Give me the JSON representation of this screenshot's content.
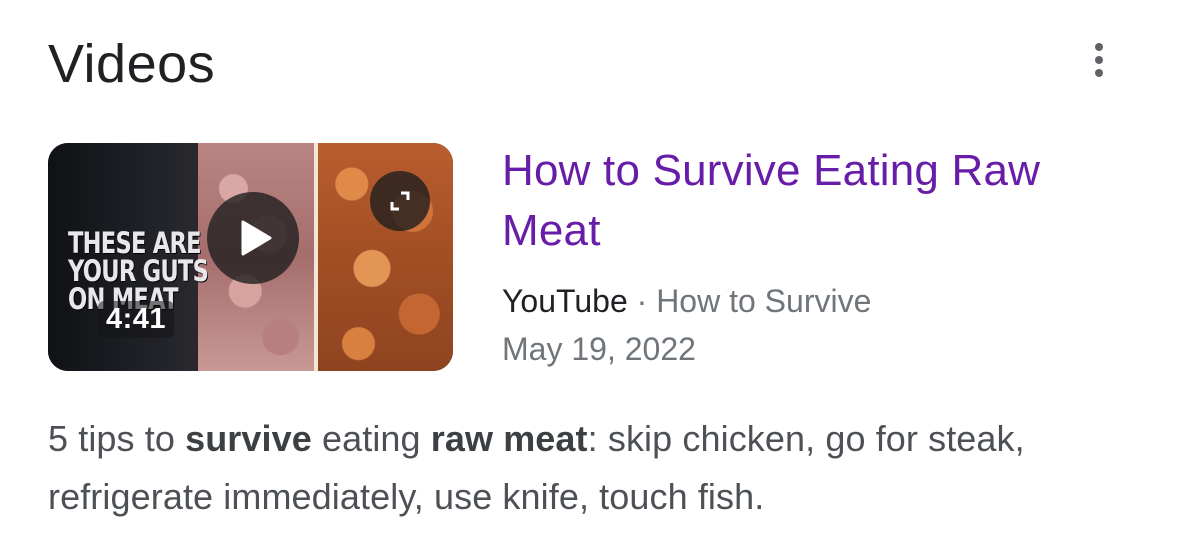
{
  "section": {
    "title": "Videos",
    "more_icon": "more-vert-icon"
  },
  "video": {
    "title": "How to Survive Eating Raw Meat",
    "duration": "4:41",
    "thumbnail_text": [
      "THESE ARE",
      "YOUR GUTS",
      "ON MEAT"
    ],
    "source": "YouTube",
    "separator": "·",
    "channel": "How to Survive",
    "date": "May 19, 2022",
    "play_icon": "play-icon",
    "expand_icon": "expand-icon"
  },
  "snippet": {
    "parts": [
      {
        "text": "5 tips to ",
        "bold": false
      },
      {
        "text": "survive",
        "bold": true
      },
      {
        "text": " eating ",
        "bold": false
      },
      {
        "text": "raw meat",
        "bold": true
      },
      {
        "text": ": skip chicken, go for steak, refrigerate immediately, use knife, touch fish.",
        "bold": false
      }
    ]
  },
  "colors": {
    "title_link": "#681da8",
    "heading": "#202124",
    "meta": "#70757a",
    "snippet": "#4d5156"
  }
}
